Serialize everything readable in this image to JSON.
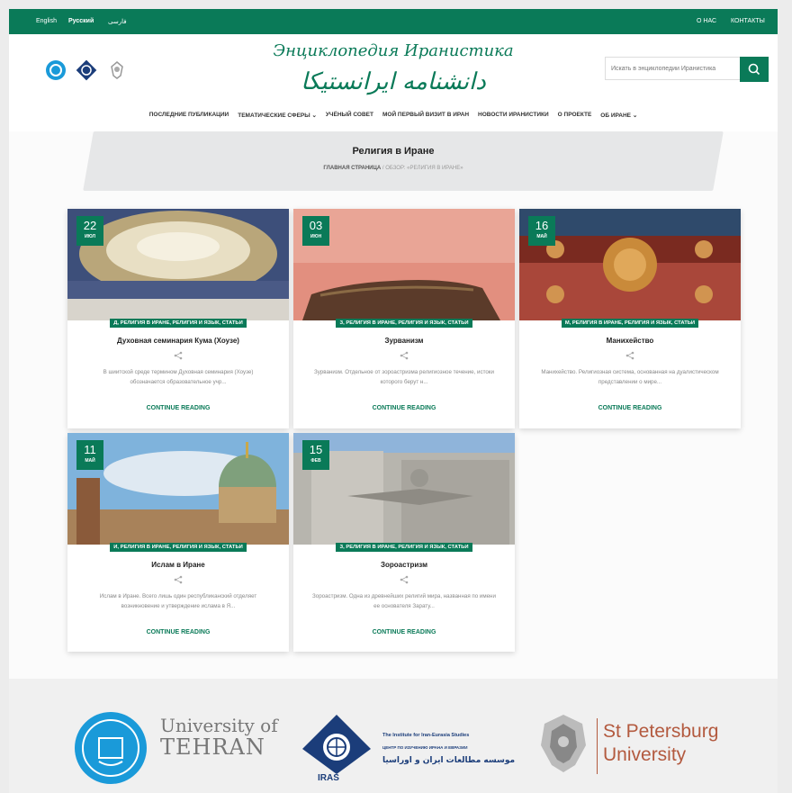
{
  "topbar": {
    "languages": [
      "English",
      "Русский",
      "فارسی"
    ],
    "links": [
      "О НАС",
      "КОНТАКТЫ"
    ]
  },
  "header": {
    "title_ru": "Энциклопедия Иранистика",
    "title_fa": "دانشنامه ایرانستیکا",
    "search_placeholder": "Искать в энциклопедии Иранистика"
  },
  "nav": [
    "ПОСЛЕДНИЕ ПУБЛИКАЦИИ",
    "ТЕМАТИЧЕСКИЕ СФЕРЫ",
    "УЧЁНЫЙ СОВЕТ",
    "МОЙ ПЕРВЫЙ ВИЗИТ В ИРАН",
    "НОВОСТИ ИРАНИСТИКИ",
    "О ПРОЕКТЕ",
    "ОБ ИРАНЕ"
  ],
  "page": {
    "title": "Религия в Иране",
    "breadcrumb_home": "ГЛАВНАЯ СТРАНИЦА",
    "breadcrumb_rest": "/ ОБЗОР: «РЕЛИГИЯ В ИРАНЕ»"
  },
  "cards": [
    {
      "day": "22",
      "month": "ИЮЛ",
      "category": "Д, РЕЛИГИЯ В ИРАНЕ, РЕЛИГИЯ И ЯЗЫК, СТАТЬИ",
      "title": "Духовная семинария Кума (Хоузе)",
      "excerpt": "В шиитской среде термином Духовная семинария (Хоузе) обозначается образовательное учр...",
      "more": "CONTINUE READING"
    },
    {
      "day": "03",
      "month": "ИЮН",
      "category": "З, РЕЛИГИЯ В ИРАНЕ, РЕЛИГИЯ И ЯЗЫК, СТАТЬИ",
      "title": "Зурванизм",
      "excerpt": "Зурванизм. Отдельное от зороастризма религиозное течение, истоки которого берут н...",
      "more": "CONTINUE READING"
    },
    {
      "day": "16",
      "month": "МАЙ",
      "category": "М, РЕЛИГИЯ В ИРАНЕ, РЕЛИГИЯ И ЯЗЫК, СТАТЬИ",
      "title": "Манихейство",
      "excerpt": "Манихейство. Религиозная система, основанная на дуалистическом представлении о мире...",
      "more": "CONTINUE READING"
    },
    {
      "day": "11",
      "month": "МАЙ",
      "category": "И, РЕЛИГИЯ В ИРАНЕ, РЕЛИГИЯ И ЯЗЫК, СТАТЬИ",
      "title": "Ислам в Иране",
      "excerpt": "Ислам в Иране. Всего лишь один республиканский отделяет возникновение и утверждение ислама в Я...",
      "more": "CONTINUE READING"
    },
    {
      "day": "15",
      "month": "ФЕВ",
      "category": "З, РЕЛИГИЯ В ИРАНЕ, РЕЛИГИЯ И ЯЗЫК, СТАТЬИ",
      "title": "Зороастризм",
      "excerpt": "Зороастризм. Одна из древнейших религий мира, названная по имени ее основателя Зарату...",
      "more": "CONTINUE READING"
    }
  ],
  "footer": {
    "ut_line1": "University of",
    "ut_line2": "TEHRAN",
    "iras_label": "IRAS",
    "iras_en": "The Institute for Iran-Eurasia Studies",
    "iras_ru": "ЦЕНТР ПО ИЗУЧЕНИЮ ИРАНА И ЕВРАЗИИ",
    "iras_fa": "موسسه مطالعات ایران و اوراسیا",
    "spbu_line1": "St Petersburg",
    "spbu_line2": "University"
  },
  "colors": {
    "brand": "#0a7a58",
    "footer_text": "#777777",
    "spbu": "#b35a3f",
    "iras": "#1b3d7a"
  }
}
